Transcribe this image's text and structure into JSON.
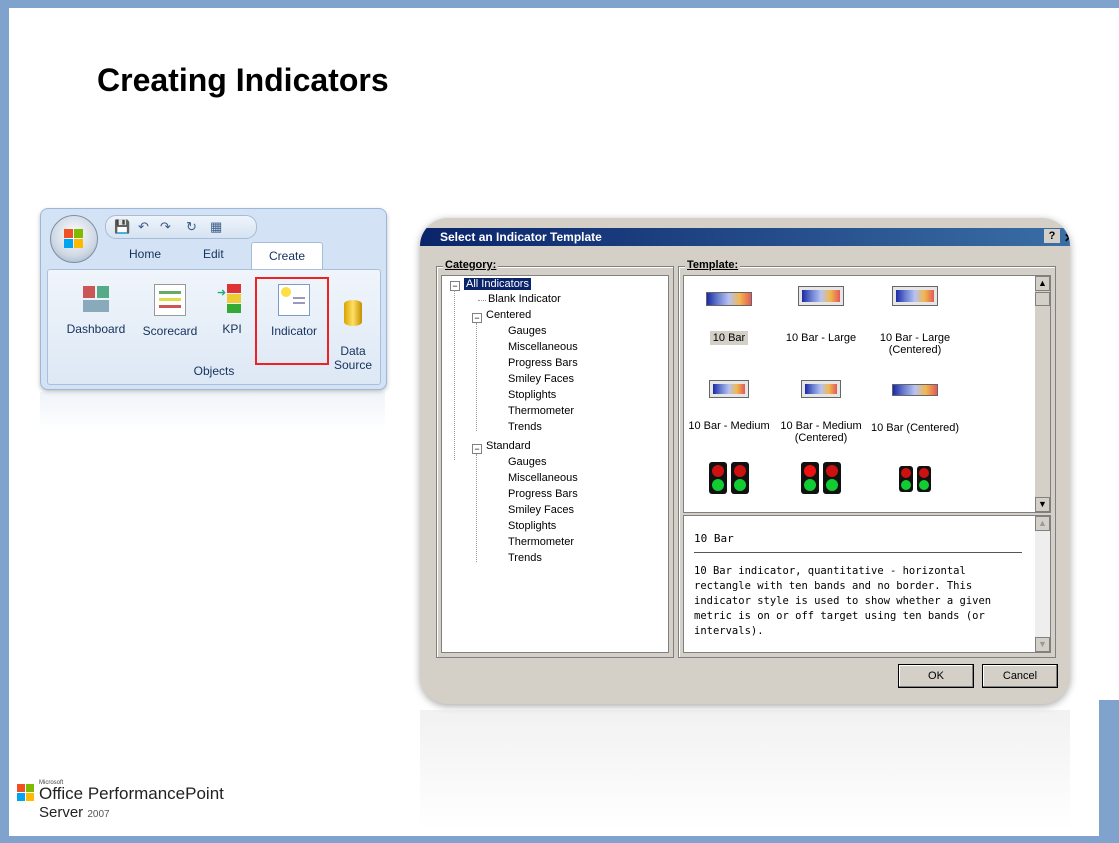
{
  "slide": {
    "title": "Creating Indicators"
  },
  "ribbon": {
    "tabs": [
      "Home",
      "Edit",
      "Create"
    ],
    "active_tab": "Create",
    "buttons": [
      {
        "label": "Dashboard",
        "icon": "dashboard-icon"
      },
      {
        "label": "Scorecard",
        "icon": "scorecard-icon"
      },
      {
        "label": "KPI",
        "icon": "kpi-icon"
      },
      {
        "label": "Indicator",
        "icon": "indicator-icon"
      },
      {
        "label": "Data\nSource",
        "icon": "data-source-icon"
      }
    ],
    "group_label": "Objects"
  },
  "dialog": {
    "title": "Select an Indicator Template",
    "help": "?",
    "category_label": "Category:",
    "template_label": "Template:",
    "tree": {
      "root": "All Indicators",
      "blank": "Blank Indicator",
      "centered": "Centered",
      "centered_children": [
        "Gauges",
        "Miscellaneous",
        "Progress Bars",
        "Smiley Faces",
        "Stoplights",
        "Thermometer",
        "Trends"
      ],
      "standard": "Standard",
      "standard_children": [
        "Gauges",
        "Miscellaneous",
        "Progress Bars",
        "Smiley Faces",
        "Stoplights",
        "Thermometer",
        "Trends"
      ]
    },
    "templates": [
      {
        "label": "10 Bar",
        "icon": "ten-bar-icon"
      },
      {
        "label": "10 Bar - Large",
        "icon": "ten-bar-large-icon"
      },
      {
        "label": "10 Bar - Large (Centered)",
        "icon": "ten-bar-large-centered-icon"
      },
      {
        "label": "10 Bar - Medium",
        "icon": "ten-bar-medium-icon"
      },
      {
        "label": "10 Bar - Medium (Centered)",
        "icon": "ten-bar-medium-centered-icon"
      },
      {
        "label": "10 Bar (Centered)",
        "icon": "ten-bar-centered-icon"
      }
    ],
    "description_title": "10 Bar",
    "description_body": "10 Bar indicator, quantitative - horizontal rectangle with ten bands and no border. This indicator style is used to show whether a given metric is on or off target using ten bands (or intervals).",
    "ok_label": "OK",
    "cancel_label": "Cancel"
  },
  "footer": {
    "brand_small": "Microsoft",
    "brand_main": "Office PerformancePoint",
    "brand_server": "Server",
    "brand_year": "2007"
  }
}
